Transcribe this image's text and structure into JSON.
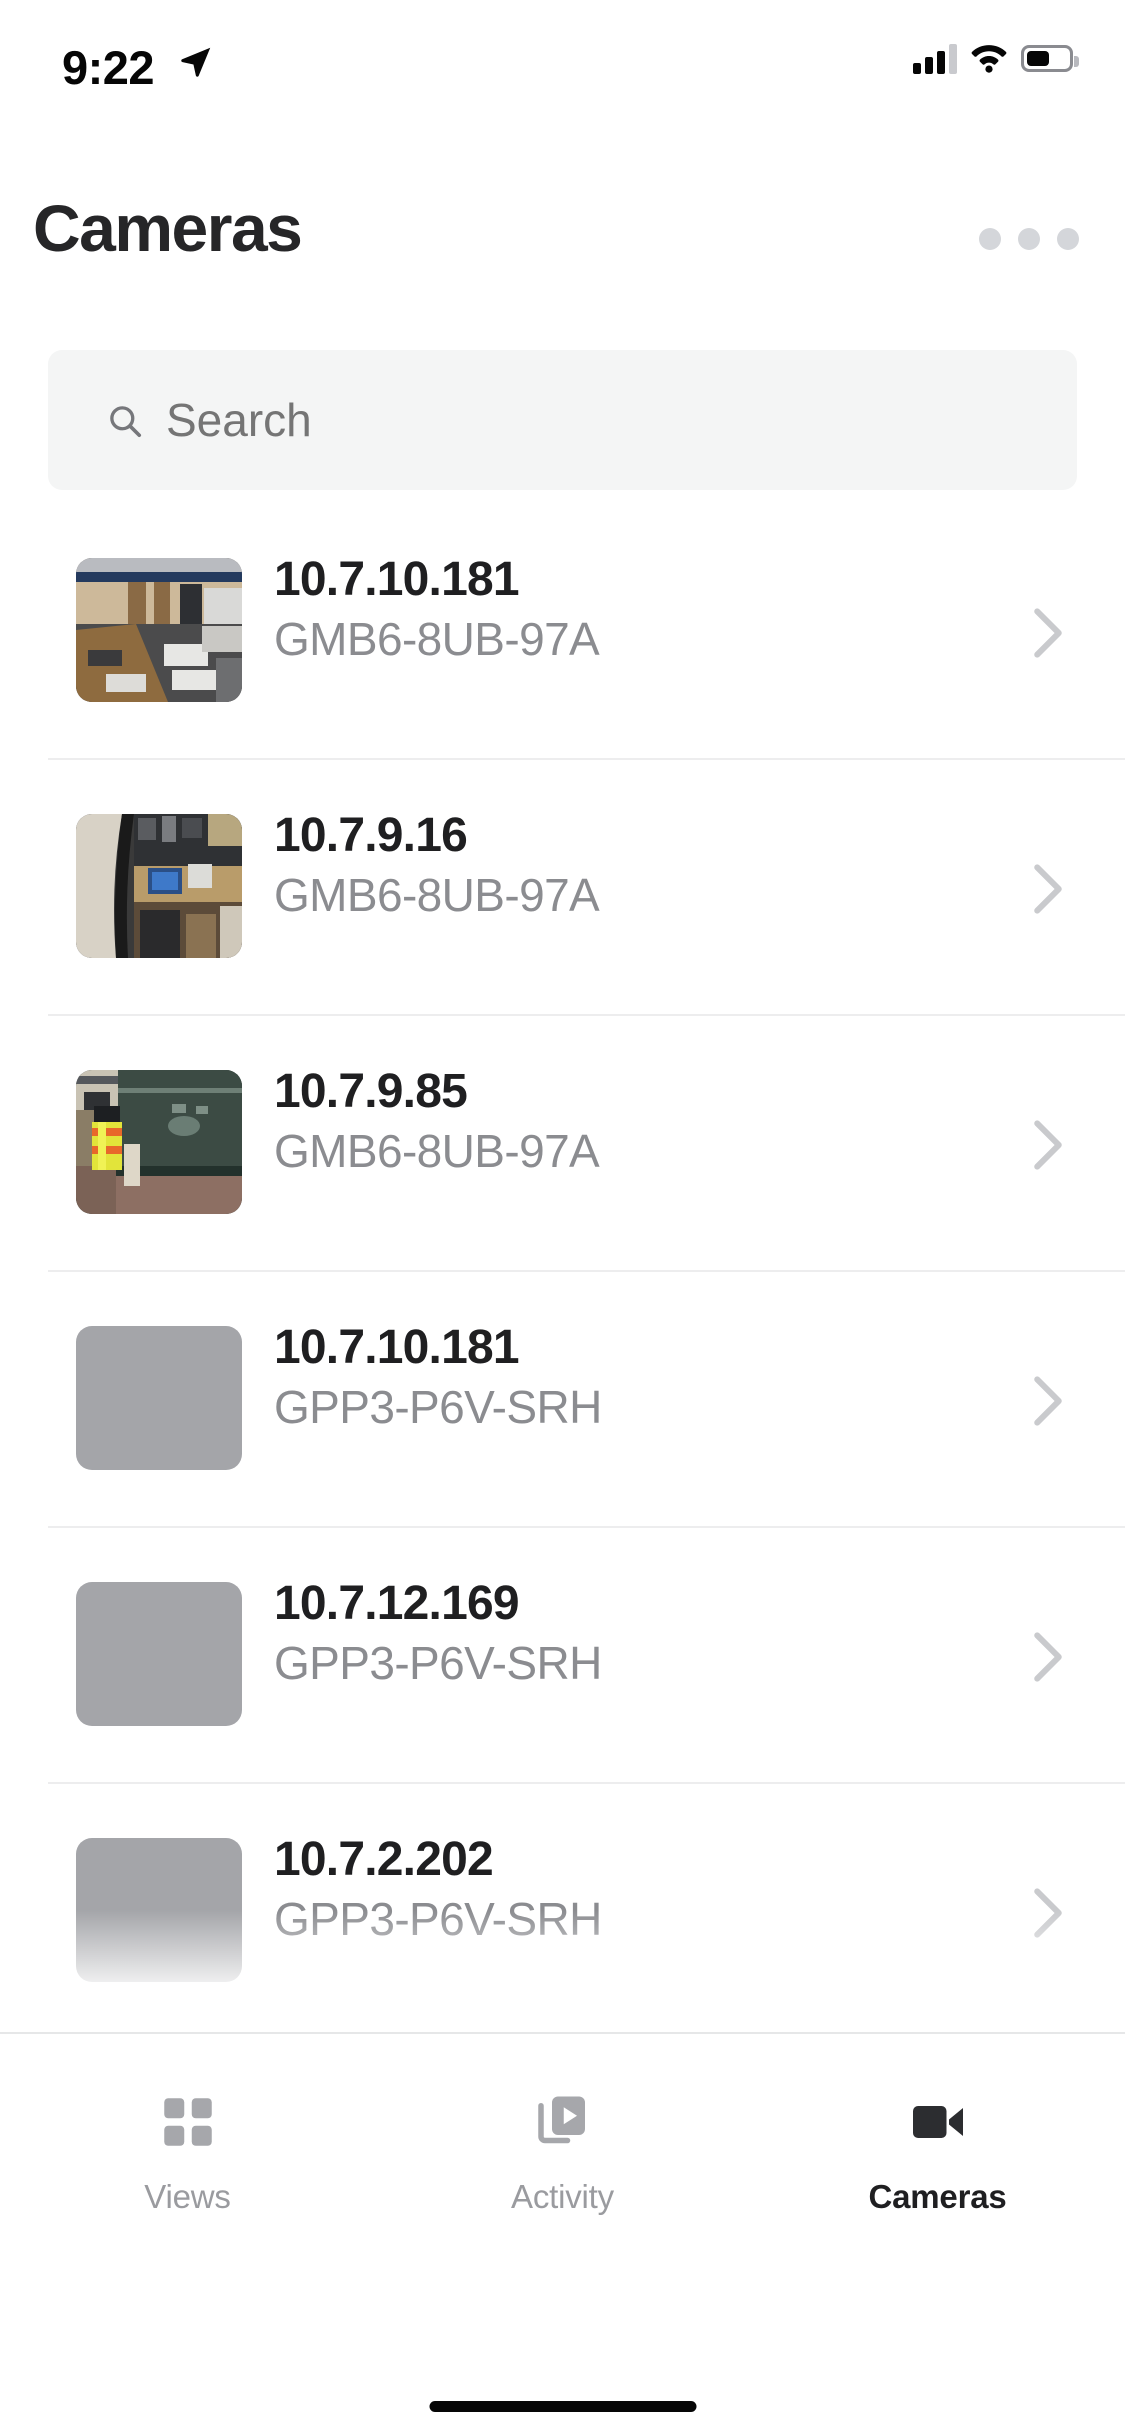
{
  "status_bar": {
    "time": "9:22",
    "location_icon": "location-arrow-icon",
    "signal_icon": "cellular-signal-icon",
    "signal_bars_filled": 3,
    "signal_bars_total": 4,
    "wifi_icon": "wifi-icon",
    "battery_icon": "battery-icon",
    "battery_percent": 48
  },
  "header": {
    "title": "Cameras",
    "more_icon": "more-horizontal-icon"
  },
  "search": {
    "placeholder": "Search",
    "value": "",
    "icon": "search-icon"
  },
  "cameras": [
    {
      "ip": "10.7.10.181",
      "serial": "GMB6-8UB-97A",
      "thumbnail": "office-desks-overhead",
      "has_preview": true
    },
    {
      "ip": "10.7.9.16",
      "serial": "GMB6-8UB-97A",
      "thumbnail": "workshop-monitor-bench",
      "has_preview": true
    },
    {
      "ip": "10.7.9.85",
      "serial": "GMB6-8UB-97A",
      "thumbnail": "corridor-hivis-vest-cart",
      "has_preview": true
    },
    {
      "ip": "10.7.10.181",
      "serial": "GPP3-P6V-SRH",
      "thumbnail": "placeholder-gray",
      "has_preview": false
    },
    {
      "ip": "10.7.12.169",
      "serial": "GPP3-P6V-SRH",
      "thumbnail": "placeholder-gray",
      "has_preview": false
    },
    {
      "ip": "10.7.2.202",
      "serial": "GPP3-P6V-SRH",
      "thumbnail": "placeholder-gray",
      "has_preview": false
    }
  ],
  "tabbar": {
    "items": [
      {
        "label": "Views",
        "icon": "grid-icon",
        "active": false
      },
      {
        "label": "Activity",
        "icon": "play-media-icon",
        "active": false
      },
      {
        "label": "Cameras",
        "icon": "video-camera-icon",
        "active": true
      }
    ]
  },
  "colors": {
    "background": "#ffffff",
    "title_text": "#262628",
    "primary_text": "#1f1f21",
    "secondary_text": "#8b8c90",
    "search_bg": "#f4f5f5",
    "placeholder_thumb": "#a4a5a9",
    "divider": "#ededee",
    "dots": "#d4d6da",
    "chevron": "#c9cacd"
  }
}
